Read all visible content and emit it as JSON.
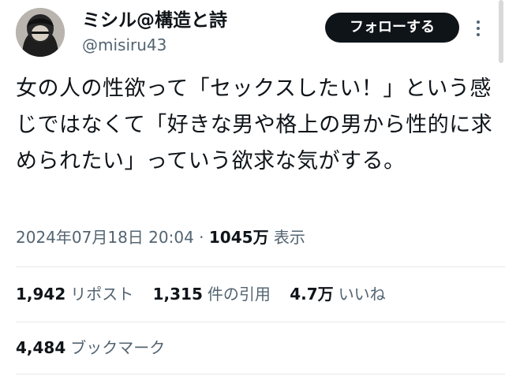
{
  "author": {
    "display_name": "ミシル@構造と詩",
    "handle": "@misiru43",
    "avatar_icon": "user-avatar"
  },
  "follow_button": {
    "label": "フォローする"
  },
  "more_icon": "more-vertical-icon",
  "tweet": {
    "text": "女の人の性欲って「セックスしたい！」という感じではなくて「好きな男や格上の男から性的に求められたい」っていう欲求な気がする。"
  },
  "meta": {
    "timestamp": "2024年07月18日 20:04",
    "separator": "·",
    "views_count": "1045万",
    "views_label": "表示"
  },
  "stats": {
    "reposts_count": "1,942",
    "reposts_label": "リポスト",
    "quotes_count": "1,315",
    "quotes_label": "件の引用",
    "likes_count": "4.7万",
    "likes_label": "いいね"
  },
  "bookmarks": {
    "count": "4,484",
    "label": "ブックマーク"
  }
}
